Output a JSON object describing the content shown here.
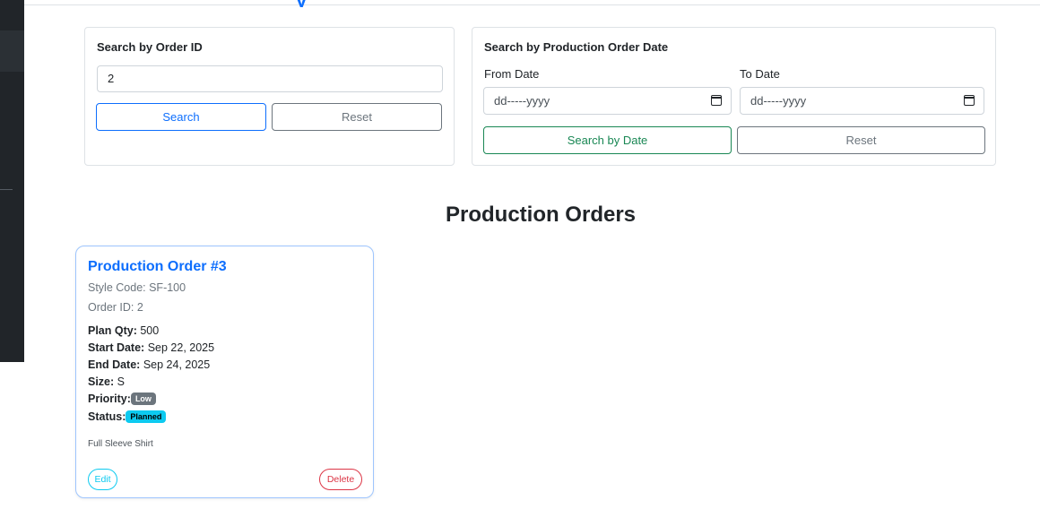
{
  "heading_fragment": "y",
  "search_by_id": {
    "title": "Search by Order ID",
    "input_value": "2",
    "search_label": "Search",
    "reset_label": "Reset"
  },
  "search_by_date": {
    "title": "Search by Production Order Date",
    "from_label": "From Date",
    "to_label": "To Date",
    "from_placeholder": "dd-----yyyy",
    "to_placeholder": "dd-----yyyy",
    "search_label": "Search by Date",
    "reset_label": "Reset"
  },
  "section_title": "Production Orders",
  "orders": [
    {
      "title": "Production Order #3",
      "style_code": "Style Code: SF-100",
      "order_id": "Order ID: 2",
      "plan_qty_label": "Plan Qty:",
      "plan_qty": "500",
      "start_date_label": "Start Date:",
      "start_date": "Sep 22, 2025",
      "end_date_label": "End Date:",
      "end_date": "Sep 24, 2025",
      "size_label": "Size:",
      "size": "S",
      "priority_label": "Priority:",
      "priority": "Low",
      "status_label": "Status:",
      "status": "Planned",
      "product": "Full Sleeve Shirt",
      "edit_label": "Edit",
      "delete_label": "Delete"
    }
  ],
  "colors": {
    "primary": "#0d6efd",
    "success": "#198754",
    "secondary": "#6c757d",
    "info": "#0dcaf0",
    "danger": "#dc3545",
    "sidebar": "#212529"
  }
}
